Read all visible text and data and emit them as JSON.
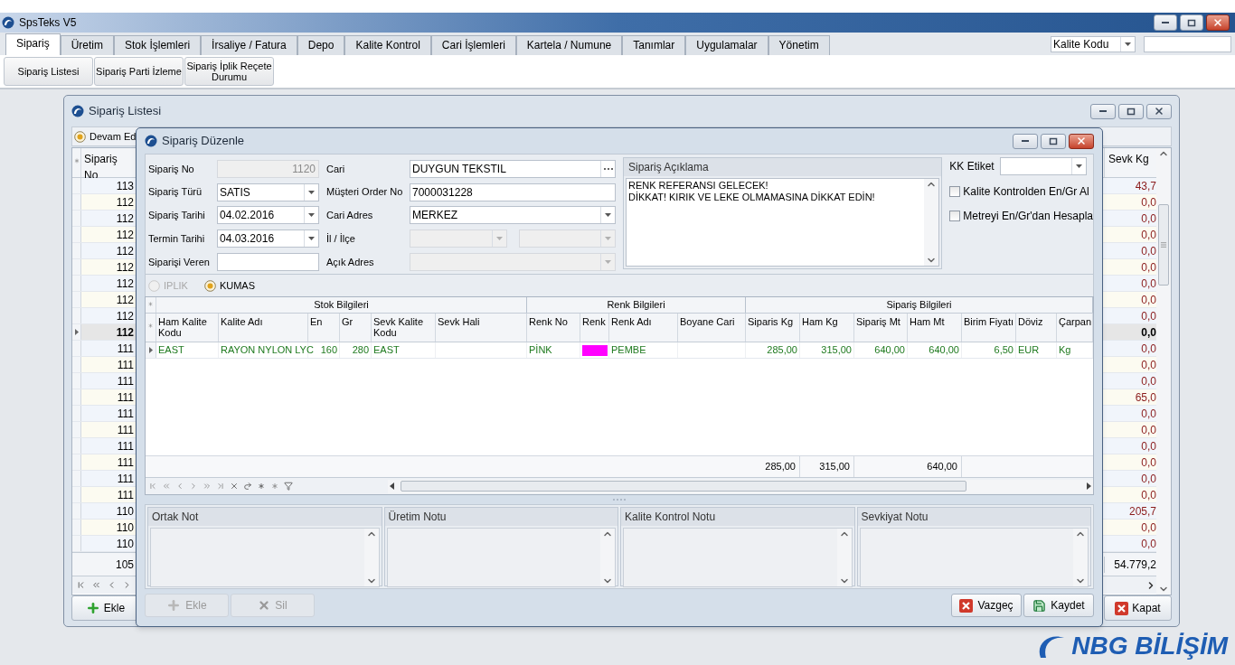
{
  "app": {
    "title": "SpsTeks V5",
    "tabs": [
      {
        "label": "Sipariş",
        "selected": true
      },
      {
        "label": "Üretim",
        "selected": false
      },
      {
        "label": "Stok İşlemleri",
        "selected": false
      },
      {
        "label": "İrsaliye / Fatura",
        "selected": false
      },
      {
        "label": "Depo",
        "selected": false
      },
      {
        "label": "Kalite Kontrol",
        "selected": false
      },
      {
        "label": "Cari İşlemleri",
        "selected": false
      },
      {
        "label": "Kartela / Numune",
        "selected": false
      },
      {
        "label": "Tanımlar",
        "selected": false
      },
      {
        "label": "Uygulamalar",
        "selected": false
      },
      {
        "label": "Yönetim",
        "selected": false
      }
    ],
    "ribbon_buttons": [
      "Sipariş Listesi",
      "Sipariş Parti İzleme",
      "Sipariş İplik Reçete Durumu"
    ],
    "search_combo": "Kalite Kodu",
    "logo": "NBG BİLİŞİM"
  },
  "list_window": {
    "title": "Sipariş Listesi",
    "filter_radio": {
      "label": "Devam Ed",
      "selected": true
    },
    "columns": [
      "Sipariş No",
      "Sevk Kg"
    ],
    "rows": [
      {
        "no": "113",
        "sevk_kg": "43,7",
        "selected": false
      },
      {
        "no": "112",
        "sevk_kg": "0,0",
        "selected": false
      },
      {
        "no": "112",
        "sevk_kg": "0,0",
        "selected": false
      },
      {
        "no": "112",
        "sevk_kg": "0,0",
        "selected": false
      },
      {
        "no": "112",
        "sevk_kg": "0,0",
        "selected": false
      },
      {
        "no": "112",
        "sevk_kg": "0,0",
        "selected": false
      },
      {
        "no": "112",
        "sevk_kg": "0,0",
        "selected": false
      },
      {
        "no": "112",
        "sevk_kg": "0,0",
        "selected": false
      },
      {
        "no": "112",
        "sevk_kg": "0,0",
        "selected": false
      },
      {
        "no": "112",
        "sevk_kg": "0,0",
        "selected": true
      },
      {
        "no": "111",
        "sevk_kg": "0,0",
        "selected": false
      },
      {
        "no": "111",
        "sevk_kg": "0,0",
        "selected": false
      },
      {
        "no": "111",
        "sevk_kg": "0,0",
        "selected": false
      },
      {
        "no": "111",
        "sevk_kg": "65,0",
        "selected": false
      },
      {
        "no": "111",
        "sevk_kg": "0,0",
        "selected": false
      },
      {
        "no": "111",
        "sevk_kg": "0,0",
        "selected": false
      },
      {
        "no": "111",
        "sevk_kg": "0,0",
        "selected": false
      },
      {
        "no": "111",
        "sevk_kg": "0,0",
        "selected": false
      },
      {
        "no": "111",
        "sevk_kg": "0,0",
        "selected": false
      },
      {
        "no": "111",
        "sevk_kg": "0,0",
        "selected": false
      },
      {
        "no": "110",
        "sevk_kg": "205,7",
        "selected": false
      },
      {
        "no": "110",
        "sevk_kg": "0,0",
        "selected": false
      },
      {
        "no": "110",
        "sevk_kg": "0,0",
        "selected": false
      }
    ],
    "footer": {
      "count": "105",
      "sevk_kg": "54.779,2"
    },
    "buttons": [
      {
        "label": "Ekle",
        "kind": "add"
      },
      {
        "label": "Kapat",
        "kind": "close"
      }
    ]
  },
  "dialog": {
    "title": "Sipariş Düzenle",
    "form_left": [
      {
        "label": "Sipariş No",
        "value": "1120",
        "kind": "readonly",
        "disabled": true
      },
      {
        "label": "Sipariş Türü",
        "value": "SATIS",
        "kind": "combo",
        "disabled": false
      },
      {
        "label": "Sipariş Tarihi",
        "value": "04.02.2016",
        "kind": "combo",
        "disabled": false
      },
      {
        "label": "Termin Tarihi",
        "value": "04.03.2016",
        "kind": "combo",
        "disabled": false
      },
      {
        "label": "Siparişi Veren",
        "kind": "text",
        "disabled": false
      }
    ],
    "form_middle": [
      {
        "label": "Cari",
        "value": "DUYGUN TEKSTIL",
        "kind": "button_edit",
        "disabled": false
      },
      {
        "label": "Müşteri Order No",
        "value": "7000031228",
        "kind": "text",
        "disabled": false
      },
      {
        "label": "Cari Adres",
        "value": "MERKEZ",
        "kind": "combo",
        "disabled": false
      },
      {
        "label": "İl / İlçe",
        "kind": "double_combo",
        "disabled": true
      },
      {
        "label": "Açık Adres",
        "kind": "combo",
        "disabled": true
      }
    ],
    "description": {
      "label": "Sipariş Açıklama",
      "lines": [
        "RENK REFERANSI GELECEK!",
        "DİKKAT! KIRIK VE LEKE OLMAMASINA DİKKAT EDİN!"
      ]
    },
    "kk_etiket": {
      "label": "KK Etiket"
    },
    "checkboxes": [
      {
        "label": "Kalite Kontrolden En/Gr Al",
        "checked": false
      },
      {
        "label": "Metreyi En/Gr'dan Hesapla",
        "checked": false
      }
    ],
    "product_types": [
      {
        "label": "IPLIK",
        "selected": false,
        "disabled": true
      },
      {
        "label": "KUMAS",
        "selected": true,
        "disabled": false
      }
    ],
    "grid": {
      "bands": [
        {
          "label": "Stok Bilgileri",
          "columns": [
            {
              "label": "Ham Kalite Kodu",
              "kind": "text"
            },
            {
              "label": "Kalite Adı",
              "kind": "text"
            },
            {
              "label": "En",
              "kind": "number"
            },
            {
              "label": "Gr",
              "kind": "number"
            },
            {
              "label": "Sevk Kalite Kodu",
              "kind": "text"
            },
            {
              "label": "Sevk Hali",
              "kind": "text"
            }
          ]
        },
        {
          "label": "Renk Bilgileri",
          "columns": [
            {
              "label": "Renk No",
              "kind": "text"
            },
            {
              "label": "Renk",
              "kind": "swatch"
            },
            {
              "label": "Renk Adı",
              "kind": "text"
            },
            {
              "label": "Boyane Cari",
              "kind": "text"
            }
          ]
        },
        {
          "label": "Sipariş Bilgileri",
          "columns": [
            {
              "label": "Siparis Kg",
              "kind": "number"
            },
            {
              "label": "Ham Kg",
              "kind": "number"
            },
            {
              "label": "Sipariş Mt",
              "kind": "number"
            },
            {
              "label": "Ham Mt",
              "kind": "number"
            },
            {
              "label": "Birim Fiyatı",
              "kind": "number"
            },
            {
              "label": "Döviz",
              "kind": "text"
            },
            {
              "label": "Çarpan",
              "kind": "text"
            }
          ]
        }
      ],
      "rows": [
        {
          "selected": true,
          "color": "#ff00ff",
          "cells": {
            "ham_kalite_kodu": "EAST",
            "kalite_adi": "RAYON NYLON LYC",
            "en": "160",
            "gr": "280",
            "sevk_kalite_kodu": "EAST",
            "renk_no": "PİNK",
            "renk_adi": "PEMBE",
            "siparis_kg": "285,00",
            "ham_kg": "315,00",
            "siparis_mt": "640,00",
            "ham_mt": "640,00",
            "birim_fiyati": "6,50",
            "doviz": "EUR",
            "carpan": "Kg"
          }
        }
      ],
      "totals": {
        "siparis_kg": "285,00",
        "ham_kg": "315,00",
        "ham_mt": "640,00"
      }
    },
    "notes": [
      "Ortak Not",
      "Üretim Notu",
      "Kalite Kontrol Notu",
      "Sevkiyat Notu"
    ],
    "buttons": [
      {
        "label": "Ekle",
        "kind": "add",
        "disabled": true
      },
      {
        "label": "Sil",
        "kind": "delete",
        "disabled": true
      },
      {
        "label": "Vazgeç",
        "kind": "cancel",
        "disabled": false
      },
      {
        "label": "Kaydet",
        "kind": "save",
        "disabled": false
      }
    ]
  }
}
